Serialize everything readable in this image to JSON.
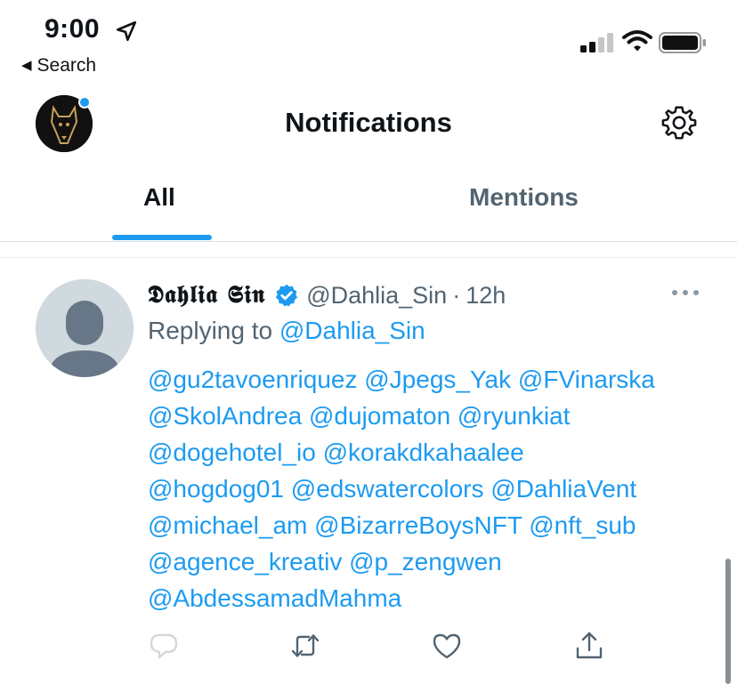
{
  "status_bar": {
    "time": "9:00",
    "back_label": "Search",
    "icons": [
      "location-arrow-icon",
      "cellular-signal-icon",
      "wifi-icon",
      "battery-icon"
    ]
  },
  "header": {
    "title": "Notifications",
    "accent_color": "#1d9bf0"
  },
  "tabs": [
    {
      "label": "All",
      "selected": true
    },
    {
      "label": "Mentions",
      "selected": false
    }
  ],
  "tweet": {
    "display_name": "𝕯𝖆𝖍𝖑𝖎𝖆 𝕾𝖎𝖓",
    "handle": "@Dahlia_Sin",
    "separator": "·",
    "time": "12h",
    "replying_prefix": "Replying to",
    "replying_to": "@Dahlia_Sin",
    "mention_lines": [
      "@gu2tavoenriquez @Jpegs_Yak @FVinarska",
      "@SkolAndrea @dujomaton @ryunkiat",
      "@dogehotel_io @korakdkahaalee",
      "@hogdog01 @edswatercolors @DahliaVent",
      "@michael_am @BizarreBoysNFT @nft_sub",
      "@agence_kreativ @p_zengwen",
      "@AbdessamadMahma"
    ],
    "actions": [
      "reply-icon",
      "retweet-icon",
      "like-icon",
      "share-icon"
    ]
  },
  "colors": {
    "link": "#1d9bf0",
    "muted": "#536471",
    "text": "#0f1419"
  }
}
